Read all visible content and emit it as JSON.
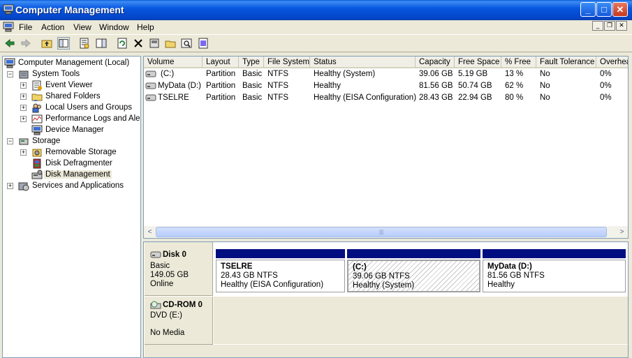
{
  "window": {
    "title": "Computer Management",
    "minimize": "_",
    "maximize": "□",
    "close": "✕"
  },
  "menubar": {
    "items": [
      "File",
      "Action",
      "View",
      "Window",
      "Help"
    ]
  },
  "toolbar": {
    "icons": [
      "back-icon",
      "forward-icon",
      "up-folder-icon",
      "show-hide-tree-icon",
      "properties-icon",
      "action-pane-icon",
      "refresh-icon",
      "delete-icon",
      "disk-properties-icon",
      "open-icon",
      "search-icon",
      "help-icon"
    ]
  },
  "tree": {
    "root": "Computer Management (Local)",
    "system_tools": "System Tools",
    "event_viewer": "Event Viewer",
    "shared_folders": "Shared Folders",
    "local_users": "Local Users and Groups",
    "perf_logs": "Performance Logs and Alerts",
    "device_manager": "Device Manager",
    "storage": "Storage",
    "removable_storage": "Removable Storage",
    "disk_defrag": "Disk Defragmenter",
    "disk_management": "Disk Management",
    "services_apps": "Services and Applications"
  },
  "volumes": {
    "columns": [
      "Volume",
      "Layout",
      "Type",
      "File System",
      "Status",
      "Capacity",
      "Free Space",
      "% Free",
      "Fault Tolerance",
      "Overhead"
    ],
    "rows": [
      [
        "(C:)",
        "Partition",
        "Basic",
        "NTFS",
        "Healthy (System)",
        "39.06 GB",
        "5.19 GB",
        "13 %",
        "No",
        "0%"
      ],
      [
        "MyData (D:)",
        "Partition",
        "Basic",
        "NTFS",
        "Healthy",
        "81.56 GB",
        "50.74 GB",
        "62 %",
        "No",
        "0%"
      ],
      [
        "TSELRE",
        "Partition",
        "Basic",
        "NTFS",
        "Healthy (EISA Configuration)",
        "28.43 GB",
        "22.94 GB",
        "80 %",
        "No",
        "0%"
      ]
    ],
    "scroll_left": "<",
    "scroll_right": ">",
    "scroll_grip": "|||"
  },
  "disks": {
    "disk0": {
      "name": "Disk 0",
      "type": "Basic",
      "size": "149.05 GB",
      "status": "Online",
      "partitions": [
        {
          "name": "TSELRE",
          "info": "28.43 GB NTFS",
          "status": "Healthy (EISA Configuration)"
        },
        {
          "name": "(C:)",
          "info": "39.06 GB NTFS",
          "status": "Healthy (System)"
        },
        {
          "name": "MyData  (D:)",
          "info": "81.56 GB NTFS",
          "status": "Healthy"
        }
      ]
    },
    "cdrom0": {
      "name": "CD-ROM 0",
      "drive": "DVD (E:)",
      "status": "No Media"
    }
  },
  "colors": {
    "titlebar": "#0858e0",
    "partition_bar": "#000e80",
    "chrome": "#ece9d8"
  }
}
